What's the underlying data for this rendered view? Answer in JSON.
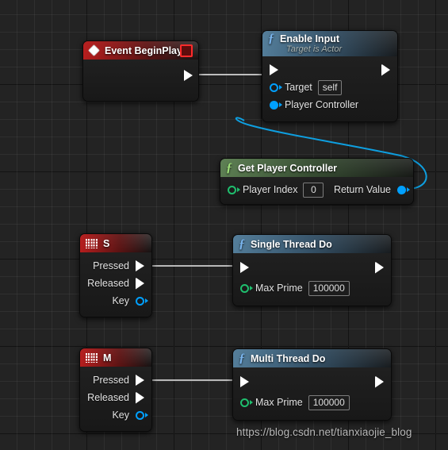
{
  "editor": {
    "name": "unreal-blueprint-event-graph",
    "background_color": "#232323",
    "grid_line_color": "#2f2f2f",
    "watermark": "https://blog.csdn.net/tianxiaojie_blog"
  },
  "palette": {
    "exec_wire": "#d8d8d8",
    "object_wire": "#0e9fe0",
    "exec_pin": "#ffffff",
    "object_pin": "#00a0ff",
    "int_pin": "#1fbf6e",
    "event_header": "#a3191a",
    "function_header": "#4d7da0",
    "pure_function_header": "#5f8456",
    "breakpoint_red": "#ff2b2b"
  },
  "nodes": [
    {
      "id": "event-begin-play",
      "kind": "event",
      "title": "Event BeginPlay",
      "icon": "diamond-icon",
      "has_breakpoint_toggle": true,
      "pins": {
        "exec_out": ""
      }
    },
    {
      "id": "enable-input",
      "kind": "function",
      "title": "Enable Input",
      "subtitle": "Target is Actor",
      "icon": "function-f-icon",
      "pins": {
        "target_label": "Target",
        "target_value": "self",
        "player_controller_label": "Player Controller"
      }
    },
    {
      "id": "get-player-controller",
      "kind": "pure-function",
      "title": "Get Player Controller",
      "icon": "function-f-icon",
      "pins": {
        "player_index_label": "Player Index",
        "player_index_value": "0",
        "return_value_label": "Return Value"
      }
    },
    {
      "id": "key-event-s",
      "kind": "event",
      "title": "S",
      "icon": "keyboard-icon",
      "pins": {
        "pressed": "Pressed",
        "released": "Released",
        "key": "Key"
      }
    },
    {
      "id": "single-thread-do",
      "kind": "function",
      "title": "Single Thread Do",
      "icon": "function-f-icon",
      "pins": {
        "max_prime_label": "Max Prime",
        "max_prime_value": "100000"
      }
    },
    {
      "id": "key-event-m",
      "kind": "event",
      "title": "M",
      "icon": "keyboard-icon",
      "pins": {
        "pressed": "Pressed",
        "released": "Released",
        "key": "Key"
      }
    },
    {
      "id": "multi-thread-do",
      "kind": "function",
      "title": "Multi Thread Do",
      "icon": "function-f-icon",
      "pins": {
        "max_prime_label": "Max Prime",
        "max_prime_value": "100000"
      }
    }
  ],
  "connections": [
    {
      "from": "event-begin-play.exec_out",
      "to": "enable-input.exec_in",
      "type": "exec"
    },
    {
      "from": "get-player-controller.return_value",
      "to": "enable-input.player_controller",
      "type": "object"
    },
    {
      "from": "key-event-s.pressed",
      "to": "single-thread-do.exec_in",
      "type": "exec"
    },
    {
      "from": "key-event-m.pressed",
      "to": "multi-thread-do.exec_in",
      "type": "exec"
    }
  ]
}
